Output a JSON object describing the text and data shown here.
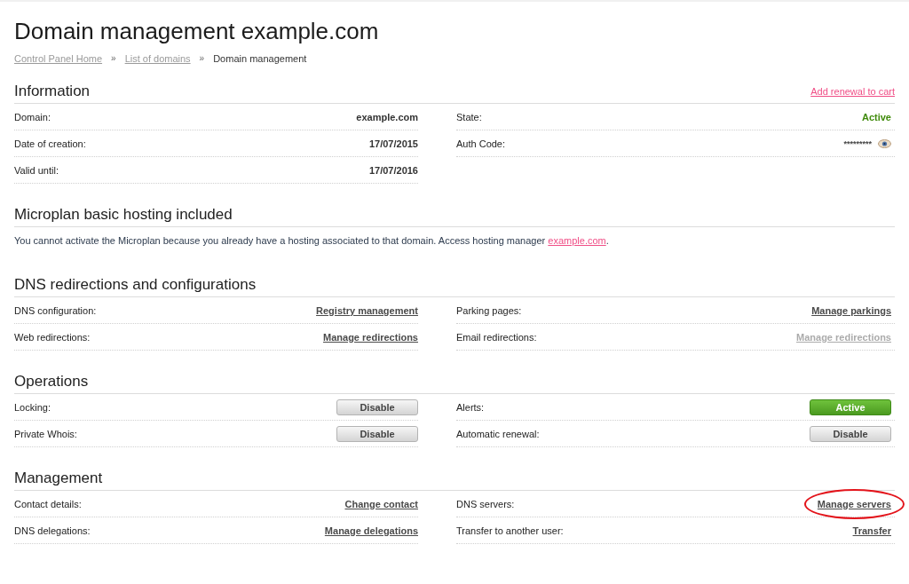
{
  "page": {
    "title": "Domain management example.com"
  },
  "breadcrumbs": [
    {
      "kind": "link",
      "label": "Control Panel Home"
    },
    {
      "kind": "separator",
      "label": "»"
    },
    {
      "kind": "link",
      "label": "List of domains"
    },
    {
      "kind": "separator",
      "label": "»"
    },
    {
      "kind": "current",
      "label": "Domain management"
    }
  ],
  "sections": [
    {
      "kind": "grid",
      "title": "Information",
      "action": {
        "label": "Add renewal to cart"
      },
      "columns": [
        {
          "rows": [
            {
              "label": "Domain:",
              "kind": "text",
              "value": "example.com"
            },
            {
              "label": "Date of creation:",
              "kind": "text",
              "value": "17/07/2015"
            },
            {
              "label": "Valid until:",
              "kind": "text",
              "value": "17/07/2016"
            }
          ]
        },
        {
          "rows": [
            {
              "label": "State:",
              "kind": "status",
              "value": "Active"
            },
            {
              "label": "Auth Code:",
              "kind": "secret",
              "value": "*********"
            }
          ]
        }
      ]
    },
    {
      "kind": "notice",
      "title": "Microplan basic hosting included",
      "text": "You cannot activate the Microplan because you already have a hosting associated to that domain. Access hosting manager ",
      "link": "example.com",
      "text_after": "."
    },
    {
      "kind": "grid",
      "title": "DNS redirections and configurations",
      "columns": [
        {
          "rows": [
            {
              "label": "DNS configuration:",
              "kind": "link",
              "value": "Registry management",
              "disabled": false,
              "circled": false
            },
            {
              "label": "Web redirections:",
              "kind": "link",
              "value": "Manage redirections",
              "disabled": false,
              "circled": false
            }
          ]
        },
        {
          "rows": [
            {
              "label": "Parking pages:",
              "kind": "link",
              "value": "Manage parkings",
              "disabled": false,
              "circled": false
            },
            {
              "label": "Email redirections:",
              "kind": "link",
              "value": "Manage redirections",
              "disabled": true,
              "circled": false
            }
          ]
        }
      ]
    },
    {
      "kind": "grid",
      "title": "Operations",
      "columns": [
        {
          "rows": [
            {
              "label": "Locking:",
              "kind": "button",
              "value": "Disable",
              "on": false
            },
            {
              "label": "Private Whois:",
              "kind": "button",
              "value": "Disable",
              "on": false
            }
          ]
        },
        {
          "rows": [
            {
              "label": "Alerts:",
              "kind": "button",
              "value": "Active",
              "on": true
            },
            {
              "label": "Automatic renewal:",
              "kind": "button",
              "value": "Disable",
              "on": false
            }
          ]
        }
      ]
    },
    {
      "kind": "grid",
      "title": "Management",
      "columns": [
        {
          "rows": [
            {
              "label": "Contact details:",
              "kind": "link",
              "value": "Change contact",
              "disabled": false,
              "circled": false
            },
            {
              "label": "DNS delegations:",
              "kind": "link",
              "value": "Manage delegations",
              "disabled": false,
              "circled": false
            }
          ]
        },
        {
          "rows": [
            {
              "label": "DNS servers:",
              "kind": "link",
              "value": "Manage servers",
              "disabled": false,
              "circled": true
            },
            {
              "label": "Transfer to another user:",
              "kind": "link",
              "value": "Transfer",
              "disabled": false,
              "circled": false
            }
          ]
        }
      ]
    }
  ]
}
